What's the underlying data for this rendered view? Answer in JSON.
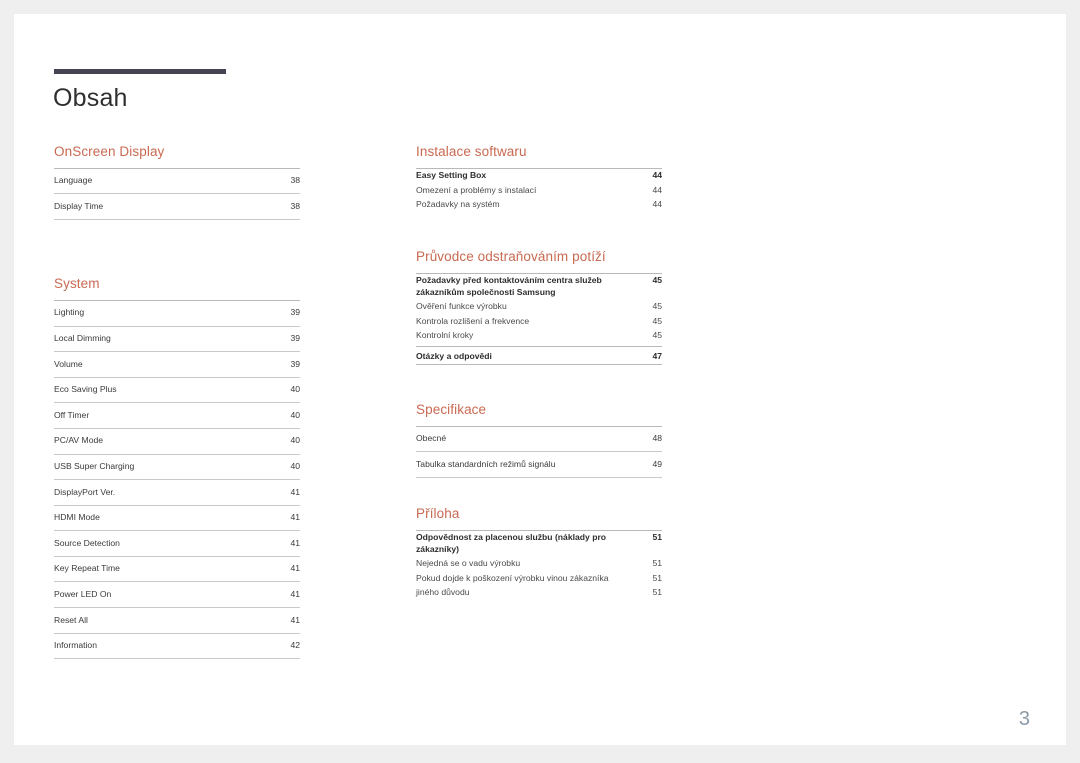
{
  "document": {
    "title": "Obsah",
    "folio": "3",
    "accent_color": "#c96a52",
    "rule_color": "#474352",
    "folio_color": "#8e9aa6"
  },
  "left_column": [
    {
      "heading": "OnScreen Display",
      "style": "ruled",
      "entries": [
        {
          "label": "Language",
          "page": "38",
          "level": "main"
        },
        {
          "label": "Display Time",
          "page": "38",
          "level": "main"
        }
      ]
    },
    {
      "heading": "System",
      "style": "ruled",
      "entries": [
        {
          "label": "Lighting",
          "page": "39",
          "level": "main"
        },
        {
          "label": "Local Dimming",
          "page": "39",
          "level": "main"
        },
        {
          "label": "Volume",
          "page": "39",
          "level": "main"
        },
        {
          "label": "Eco Saving Plus",
          "page": "40",
          "level": "main"
        },
        {
          "label": "Off Timer",
          "page": "40",
          "level": "main"
        },
        {
          "label": "PC/AV Mode",
          "page": "40",
          "level": "main"
        },
        {
          "label": "USB Super Charging",
          "page": "40",
          "level": "main"
        },
        {
          "label": "DisplayPort Ver.",
          "page": "41",
          "level": "main"
        },
        {
          "label": "HDMI Mode",
          "page": "41",
          "level": "main"
        },
        {
          "label": "Source Detection",
          "page": "41",
          "level": "main"
        },
        {
          "label": "Key Repeat Time",
          "page": "41",
          "level": "main"
        },
        {
          "label": "Power LED On",
          "page": "41",
          "level": "main"
        },
        {
          "label": "Reset All",
          "page": "41",
          "level": "main"
        },
        {
          "label": "Information",
          "page": "42",
          "level": "main"
        }
      ]
    }
  ],
  "right_column": [
    {
      "heading": "Instalace softwaru",
      "style": "compact",
      "entries": [
        {
          "label": "Easy Setting Box",
          "page": "44",
          "level": "main"
        },
        {
          "label": "Omezení a problémy s instalací",
          "page": "44",
          "level": "sub"
        },
        {
          "label": "Požadavky na systém",
          "page": "44",
          "level": "sub"
        }
      ]
    },
    {
      "heading": "Průvodce odstraňováním potíží",
      "style": "compact",
      "entries": [
        {
          "label": "Požadavky před kontaktováním centra služeb zákazníkům společnosti Samsung",
          "page": "45",
          "level": "main"
        },
        {
          "label": "Ověření funkce výrobku",
          "page": "45",
          "level": "sub"
        },
        {
          "label": "Kontrola rozlišení a frekvence",
          "page": "45",
          "level": "sub"
        },
        {
          "label": "Kontrolní kroky",
          "page": "45",
          "level": "sub"
        }
      ],
      "closing_entries": [
        {
          "label": "Otázky a odpovědi",
          "page": "47",
          "level": "main"
        }
      ]
    },
    {
      "heading": "Specifikace",
      "style": "ruled",
      "entries": [
        {
          "label": "Obecné",
          "page": "48",
          "level": "main"
        },
        {
          "label": "Tabulka standardních režimů signálu",
          "page": "49",
          "level": "main"
        }
      ]
    },
    {
      "heading": "Příloha",
      "style": "compact",
      "entries": [
        {
          "label": "Odpovědnost za placenou službu (náklady pro zákazníky)",
          "page": "51",
          "level": "main"
        },
        {
          "label": "Nejedná se o vadu výrobku",
          "page": "51",
          "level": "sub"
        },
        {
          "label": "Pokud dojde k poškození výrobku vinou zákazníka",
          "page": "51",
          "level": "sub"
        },
        {
          "label": "jiného důvodu",
          "page": "51",
          "level": "sub"
        }
      ]
    }
  ]
}
